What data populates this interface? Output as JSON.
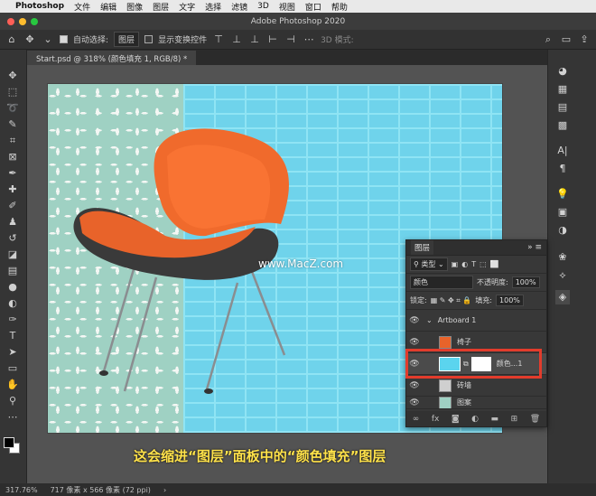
{
  "menubar": {
    "app": "Photoshop",
    "items": [
      "文件",
      "编辑",
      "图像",
      "图层",
      "文字",
      "选择",
      "滤镜",
      "3D",
      "视图",
      "窗口",
      "帮助"
    ]
  },
  "window": {
    "title": "Adobe Photoshop 2020"
  },
  "options": {
    "auto_select_label": "自动选择:",
    "auto_select_value": "图层",
    "transform_label": "显示变换控件",
    "mode3d": "3D 模式:"
  },
  "document": {
    "tab": "Start.psd @ 318% (颜色填充 1, RGB/8) *"
  },
  "canvas": {
    "watermark": "www.MacZ.com",
    "subtitle": "这会缩进“图层”面板中的“颜色填充”图层"
  },
  "layers_panel": {
    "title": "图层",
    "filter": "类型",
    "blend": "颜色",
    "opacity_label": "不透明度:",
    "opacity": "100%",
    "lock_label": "锁定:",
    "fill_label": "填充:",
    "fill": "100%",
    "layers": [
      {
        "name": "Artboard 1"
      },
      {
        "name": "椅子"
      },
      {
        "name": "颜色...1"
      },
      {
        "name": "砖墙"
      },
      {
        "name": "图案"
      }
    ]
  },
  "status": {
    "zoom": "317.76%",
    "size": "717 像素 x 566 像素 (72 ppi)"
  },
  "colors": {
    "highlight": "#e23c2c",
    "subtitle": "#ffe24a",
    "fill_color": "#5bd4ee"
  }
}
